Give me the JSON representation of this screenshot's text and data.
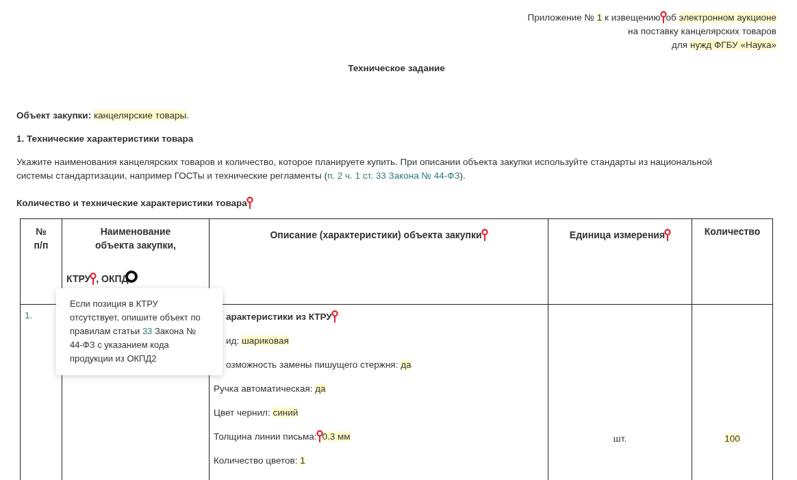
{
  "annex": [
    [
      {
        "kind": "plain",
        "text": "Приложение № "
      },
      {
        "kind": "highlight",
        "text": "1"
      },
      {
        "kind": "plain",
        "text": " к извещению"
      },
      {
        "kind": "pin"
      },
      {
        "kind": "plain",
        "text": "об "
      },
      {
        "kind": "highlight",
        "text": "электронном аукционе"
      }
    ],
    [
      {
        "kind": "plain",
        "text": "на поставку канцелярских товаров"
      }
    ],
    [
      {
        "kind": "plain",
        "text": "для "
      },
      {
        "kind": "highlight",
        "text": "нужд ФГБУ «Наука»"
      }
    ]
  ],
  "title": "Техническое задание",
  "object": [
    {
      "kind": "bold",
      "text": "Объект закупки: "
    },
    {
      "kind": "highlight",
      "text": "канцелярские товары"
    },
    {
      "kind": "plain",
      "text": "."
    }
  ],
  "section": "1. Технические характеристики товара",
  "intro": [
    {
      "kind": "plain",
      "text": "Укажите наименования канцелярских товаров и количество, которое планируете купить. При описании объекта закупки используйте стандарты из национальной системы стандартизации, например ГОСТы и технические регламенты ("
    },
    {
      "kind": "link",
      "text": "п. 2 ч. 1 ст. 33 Закона № 44-ФЗ"
    },
    {
      "kind": "plain",
      "text": ")."
    }
  ],
  "table_title": [
    {
      "kind": "bold",
      "text": "Количество и технические характеристики товара"
    },
    {
      "kind": "pin"
    }
  ],
  "table": {
    "columns": [
      {
        "kind": "number",
        "title": [
          {
            "kind": "plain",
            "text": "№ п/п"
          }
        ]
      },
      {
        "kind": "name",
        "title": [
          {
            "kind": "plain",
            "text": "Наименование объекта закупки,"
          }
        ],
        "subtitle": [
          {
            "kind": "plain",
            "text": "КТРУ"
          },
          {
            "kind": "pin"
          },
          {
            "kind": "plain",
            "text": ", ОКПД"
          },
          {
            "kind": "cursor"
          }
        ]
      },
      {
        "kind": "description",
        "title": [
          {
            "kind": "plain",
            "text": "Описание (характеристики) объекта закупки"
          },
          {
            "kind": "pin"
          }
        ]
      },
      {
        "kind": "unit",
        "title": [
          {
            "kind": "plain",
            "text": "Единица измерения"
          },
          {
            "kind": "pin"
          }
        ]
      },
      {
        "kind": "quantity",
        "title": [
          {
            "kind": "plain",
            "text": "Количество"
          }
        ]
      }
    ],
    "rows": [
      {
        "number": "1.",
        "description": [
          {
            "kind": "heading",
            "covered": true,
            "segments": [
              {
                "kind": "bold",
                "text": "арактеристики из КТРУ"
              },
              {
                "kind": "pin"
              }
            ]
          },
          {
            "kind": "property",
            "covered": true,
            "segments": [
              {
                "kind": "plain",
                "text": "ид: "
              },
              {
                "kind": "highlight",
                "text": "шариковая"
              }
            ]
          },
          {
            "kind": "property",
            "covered": true,
            "segments": [
              {
                "kind": "plain",
                "text": "озможность замены пишущего стержня: "
              },
              {
                "kind": "highlight",
                "text": "да"
              }
            ]
          },
          {
            "kind": "property",
            "covered": false,
            "segments": [
              {
                "kind": "plain",
                "text": "Ручка автоматическая: "
              },
              {
                "kind": "highlight",
                "text": "да"
              }
            ]
          },
          {
            "kind": "property",
            "covered": false,
            "segments": [
              {
                "kind": "plain",
                "text": "Цвет чернил: "
              },
              {
                "kind": "highlight",
                "text": "синий"
              }
            ]
          },
          {
            "kind": "property",
            "covered": false,
            "segments": [
              {
                "kind": "plain",
                "text": "Толщина линии письма:"
              },
              {
                "kind": "pin"
              },
              {
                "kind": "highlight",
                "text": "0.3 мм"
              }
            ]
          },
          {
            "kind": "property",
            "covered": false,
            "segments": [
              {
                "kind": "plain",
                "text": "Количество цветов: "
              },
              {
                "kind": "highlight",
                "text": "1"
              }
            ]
          }
        ],
        "unit": "шт.",
        "quantity": [
          {
            "kind": "highlight",
            "text": "100"
          }
        ]
      }
    ]
  },
  "tooltip": [
    {
      "kind": "plain",
      "text": "Если позиция в КТРУ отсутствует, опишите объект по правилам статьи "
    },
    {
      "kind": "link",
      "text": "33"
    },
    {
      "kind": "plain",
      "text": " Закона № 44-ФЗ с указанием кода продукции из ОКПД2"
    }
  ]
}
